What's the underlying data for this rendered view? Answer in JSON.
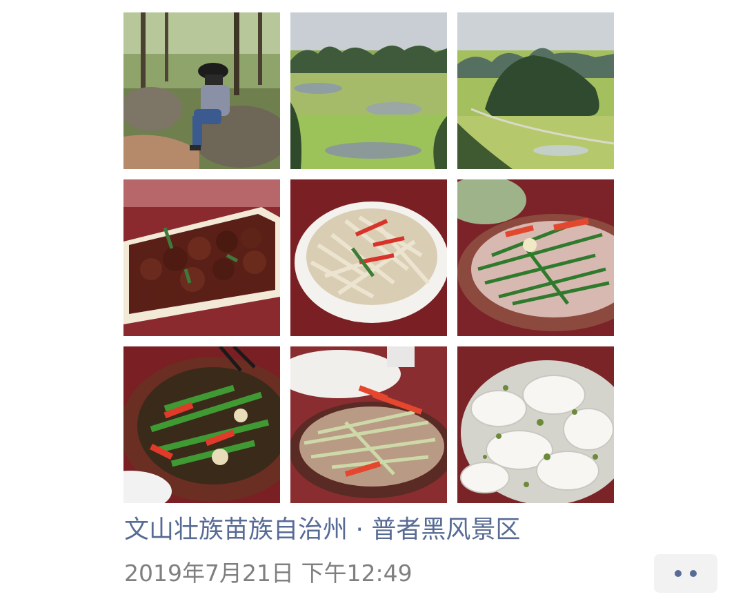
{
  "post": {
    "location": "文山壮族苗族自治州 · 普者黑风景区",
    "timestamp": "2019年7月21日 下午12:49",
    "more_icon": "ellipsis-icon"
  },
  "photos": [
    {
      "subject": "person sitting on rock in forest"
    },
    {
      "subject": "karst hills and green fields"
    },
    {
      "subject": "karst hills valley with road"
    },
    {
      "subject": "braised pork ribs dish"
    },
    {
      "subject": "stir-fried lotus root strips with red pepper"
    },
    {
      "subject": "chive and meat stir-fry"
    },
    {
      "subject": "stir-fried green pepper and mushroom"
    },
    {
      "subject": "shredded meat with celery and pepper"
    },
    {
      "subject": "lotus root slices with herbs"
    }
  ],
  "colors": {
    "link": "#576b95",
    "meta": "#7f7f7f",
    "button_bg": "#f2f2f3"
  }
}
